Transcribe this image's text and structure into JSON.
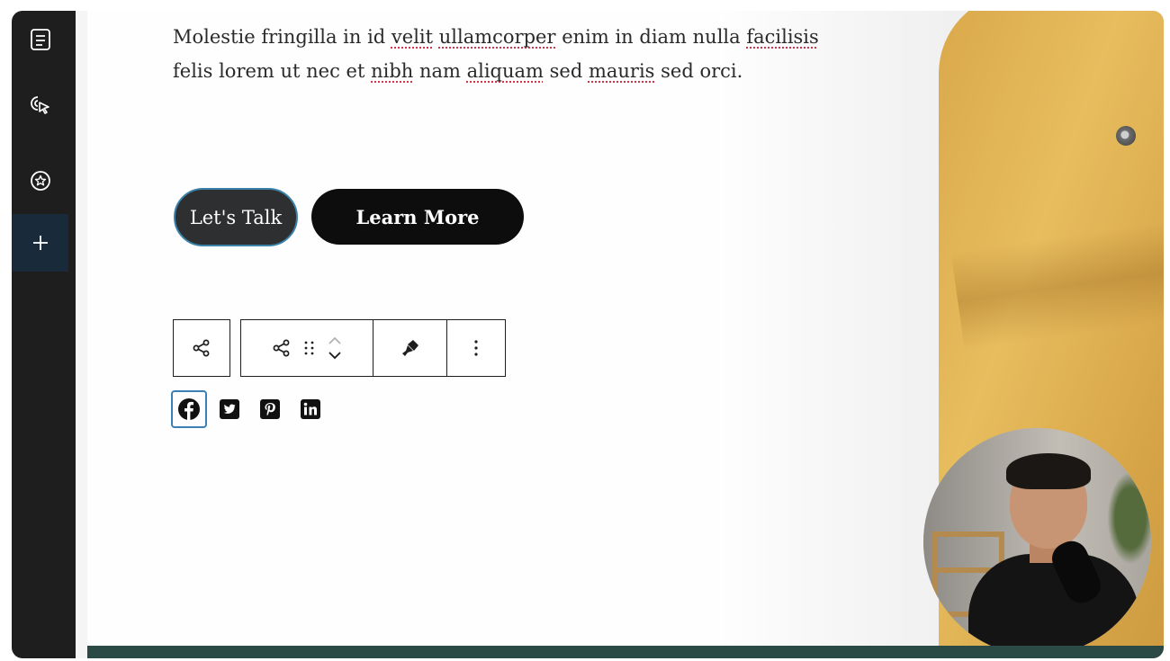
{
  "sidebar": {
    "items": [
      {
        "icon": "document-list-icon"
      },
      {
        "icon": "pointer-click-icon"
      },
      {
        "icon": "star-circle-icon"
      },
      {
        "icon": "plus-icon",
        "active": true
      }
    ]
  },
  "content": {
    "paragraph_line1_parts": [
      "Molestie fringilla in id ",
      "velit",
      " ",
      "ullamcorper",
      " enim in diam nulla ",
      "facilisis"
    ],
    "paragraph_line2_parts": [
      " felis lorem ut nec et ",
      "nibh",
      " nam ",
      "aliquam",
      " sed ",
      "mauris",
      " sed orci."
    ]
  },
  "buttons": {
    "lets_talk": "Let's Talk",
    "learn_more": "Learn More"
  },
  "block_toolbar": {
    "parent_icon": "share-icon",
    "block_icon": "share-icon",
    "drag_icon": "drag-handle-icon",
    "move_up_icon": "chevron-up-icon",
    "move_down_icon": "chevron-down-icon",
    "style_icon": "paintbrush-icon",
    "options_icon": "more-vertical-icon"
  },
  "social_links": [
    {
      "icon": "facebook-icon",
      "selected": true
    },
    {
      "icon": "twitter-icon"
    },
    {
      "icon": "pinterest-icon"
    },
    {
      "icon": "linkedin-icon"
    }
  ],
  "colors": {
    "sidebar_bg": "#1e1e1e",
    "active_item": "#192b3a",
    "button_dark": "#2d2f31",
    "button_black": "#0d0d0d",
    "selection": "#3a80b6",
    "footer_band": "#2b4a45",
    "jacket": "#e0b454"
  }
}
